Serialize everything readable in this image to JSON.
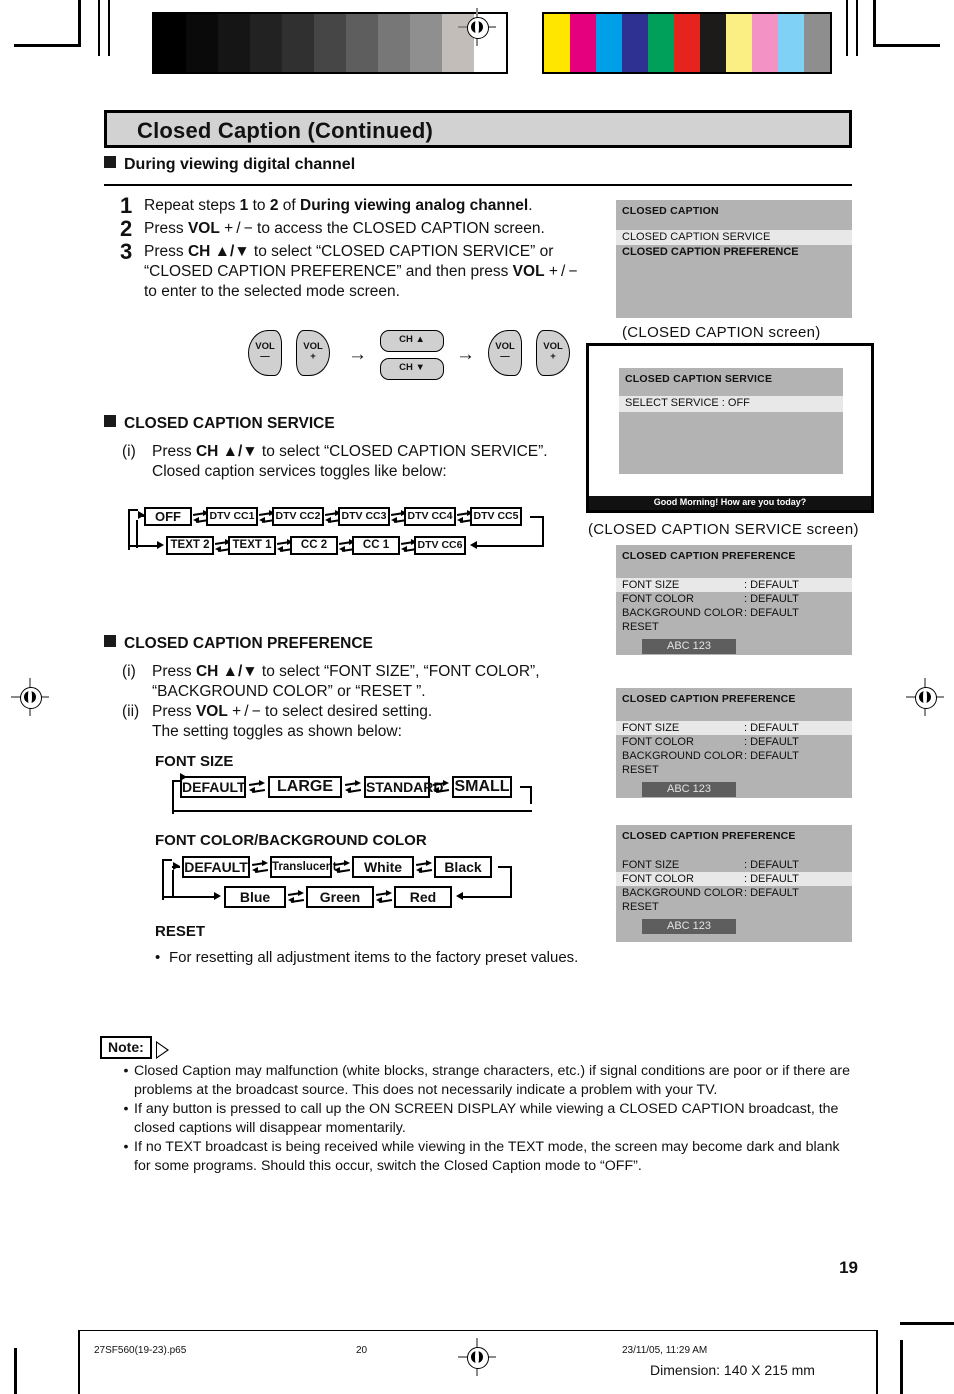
{
  "page": {
    "title": "Closed Caption (Continued)",
    "section_heading": "During viewing digital channel",
    "page_number": "19"
  },
  "steps": [
    {
      "num": "1",
      "parts": [
        {
          "t": "Repeat steps ",
          "b": false
        },
        {
          "t": "1",
          "b": true
        },
        {
          "t": " to ",
          "b": false
        },
        {
          "t": "2",
          "b": true
        },
        {
          "t": " of ",
          "b": false
        },
        {
          "t": "During viewing analog channel",
          "b": true
        },
        {
          "t": ".",
          "b": false
        }
      ]
    },
    {
      "num": "2",
      "parts": [
        {
          "t": "Press ",
          "b": false
        },
        {
          "t": "VOL",
          "b": true
        },
        {
          "t": " + / −  to access the CLOSED CAPTION screen.",
          "b": false
        }
      ]
    },
    {
      "num": "3",
      "parts": [
        {
          "t": "Press ",
          "b": false
        },
        {
          "t": "CH ▲/▼",
          "b": true
        },
        {
          "t": " to select “CLOSED CAPTION SERVICE” or “CLOSED CAPTION PREFERENCE” and then press ",
          "b": false
        },
        {
          "t": "VOL",
          "b": true
        },
        {
          "t": "  + / −  to enter to the selected mode screen.",
          "b": false
        }
      ]
    }
  ],
  "keys": {
    "vol_minus": "VOL\n—",
    "vol_plus": "VOL\n+",
    "ch_up": "CH ▲",
    "ch_down": "CH ▼",
    "arrow": "→"
  },
  "service_section": {
    "heading": "CLOSED CAPTION SERVICE",
    "item_label": "(i)",
    "line1_parts": [
      {
        "t": "Press ",
        "b": false
      },
      {
        "t": "CH ▲/▼",
        "b": true
      },
      {
        "t": " to select “CLOSED CAPTION SERVICE”.",
        "b": false
      }
    ],
    "line2": "Closed caption services toggles like below:",
    "chain_row1": [
      "OFF",
      "DTV CC1",
      "DTV CC2",
      "DTV CC3",
      "DTV CC4",
      "DTV CC5"
    ],
    "chain_row2": [
      "TEXT 2",
      "TEXT 1",
      "CC 2",
      "CC 1",
      "DTV CC6"
    ]
  },
  "preference_section": {
    "heading": "CLOSED CAPTION PREFERENCE",
    "item_i": "(i)",
    "line_i_parts": [
      {
        "t": "Press  ",
        "b": false
      },
      {
        "t": "CH ▲/▼",
        "b": true
      },
      {
        "t": "  to  select  “FONT  SIZE”,  “FONT COLOR”, “BACKGROUND COLOR” or “RESET ”.",
        "b": false
      }
    ],
    "item_ii": "(ii)",
    "line_ii_parts": [
      {
        "t": "Press ",
        "b": false
      },
      {
        "t": "VOL",
        "b": true
      },
      {
        "t": " + / −  to select desired setting.",
        "b": false
      }
    ],
    "line_ii_b": "The setting toggles as shown below:",
    "font_size_title": "FONT SIZE",
    "font_size_chain": [
      "DEFAULT",
      "LARGE",
      "STANDARD",
      "SMALL"
    ],
    "font_color_title": "FONT COLOR/BACKGROUND COLOR",
    "font_color_chain_row1": [
      "DEFAULT",
      "Translucent",
      "White",
      "Black"
    ],
    "font_color_chain_row2": [
      "Blue",
      "Green",
      "Red"
    ],
    "reset_title": "RESET",
    "reset_text": "For resetting all adjustment items to the factory preset values."
  },
  "screens": {
    "cc": {
      "header": "CLOSED CAPTION",
      "rows": [
        {
          "label": "CLOSED CAPTION SERVICE",
          "highlight": true,
          "bold": false
        },
        {
          "label": "CLOSED CAPTION PREFERENCE",
          "highlight": false,
          "bold": true
        }
      ],
      "caption": "(CLOSED  CAPTION  screen)"
    },
    "ccs": {
      "header": "CLOSED CAPTION SERVICE",
      "rows": [
        {
          "label": "SELECT SERVICE : OFF",
          "highlight": true,
          "bold": false
        }
      ],
      "caption_bar": "Good Morning! How are you today?",
      "caption": "(CLOSED  CAPTION  SERVICE  screen)"
    },
    "pref1": {
      "header": "CLOSED CAPTION PREFERENCE",
      "rows": [
        {
          "label": "FONT SIZE",
          "value": ": DEFAULT",
          "highlight": true
        },
        {
          "label": "FONT COLOR",
          "value": ": DEFAULT",
          "highlight": false
        },
        {
          "label": "BACKGROUND COLOR",
          "value": ": DEFAULT",
          "highlight": false
        },
        {
          "label": "RESET",
          "value": "",
          "highlight": false
        }
      ],
      "sample": "ABC 123"
    },
    "pref2": {
      "header": "CLOSED CAPTION PREFERENCE",
      "rows": [
        {
          "label": "FONT SIZE",
          "value": ": DEFAULT",
          "highlight": true
        },
        {
          "label": "FONT COLOR",
          "value": ": DEFAULT",
          "highlight": false
        },
        {
          "label": "BACKGROUND COLOR",
          "value": ": DEFAULT",
          "highlight": false
        },
        {
          "label": "RESET",
          "value": "",
          "highlight": false
        }
      ],
      "sample": "ABC 123"
    },
    "pref3": {
      "header": "CLOSED CAPTION PREFERENCE",
      "rows": [
        {
          "label": "FONT SIZE",
          "value": ": DEFAULT",
          "highlight": false
        },
        {
          "label": "FONT COLOR",
          "value": ": DEFAULT",
          "highlight": true
        },
        {
          "label": "BACKGROUND COLOR",
          "value": ": DEFAULT",
          "highlight": false
        },
        {
          "label": "RESET",
          "value": "",
          "highlight": false
        }
      ],
      "sample": "ABC 123"
    }
  },
  "note": {
    "label": "Note:",
    "bullets": [
      "Closed Caption may malfunction (white blocks, strange characters, etc.) if signal conditions are poor or if there are problems at the broadcast source. This does not necessarily indicate a problem with your TV.",
      "If any button is pressed to call up the ON SCREEN DISPLAY while viewing a CLOSED CAPTION broadcast, the closed captions will disappear momentarily.",
      "If no TEXT broadcast is being received while viewing in the TEXT mode, the screen may become dark and blank for some programs. Should this occur, switch the Closed Caption mode to “OFF”."
    ]
  },
  "footer": {
    "filename": "27SF560(19-23).p65",
    "folio": "20",
    "timestamp": "23/11/05, 11:29 AM",
    "dimension": "Dimension: 140  X 215 mm"
  },
  "printmarks": {
    "grayscale": [
      "#000000",
      "#0a0a0a",
      "#151515",
      "#222222",
      "#303030",
      "#464646",
      "#5e5e5e",
      "#777777",
      "#8f8f8f",
      "#c2bdb8",
      "#ffffff"
    ],
    "colorbars": [
      "#ffe600",
      "#e5007e",
      "#00a0e9",
      "#2e3192",
      "#00a05a",
      "#e7231e",
      "#1d1b1a",
      "#fbef84",
      "#f392c4",
      "#7fd2f5",
      "#8e8e8e"
    ]
  }
}
